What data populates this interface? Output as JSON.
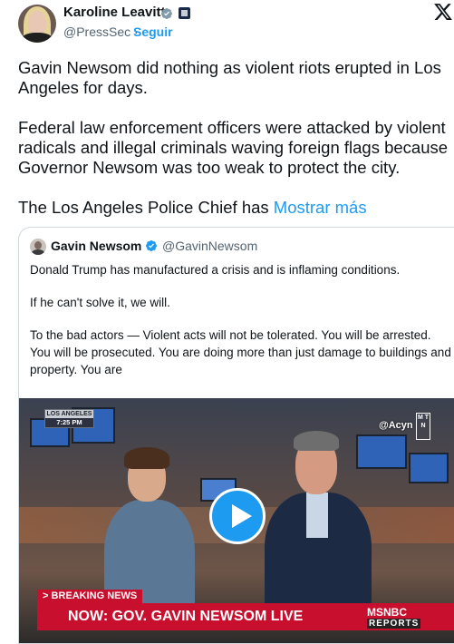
{
  "tweet": {
    "author_name": "Karoline Leavitt",
    "handle": "@PressSec",
    "separator": "·",
    "follow_label": "Seguir",
    "paragraphs": [
      "Gavin Newsom did nothing as violent riots erupted in Los Angeles for days.",
      "Federal law enforcement officers were attacked by violent radicals and illegal criminals waving foreign flags because Governor Newsom was too weak to protect the city."
    ],
    "truncated_text": "The Los Angeles Police Chief has",
    "show_more_label": "Mostrar más"
  },
  "quote": {
    "author_name": "Gavin Newsom",
    "handle": "@GavinNewsom",
    "paragraphs": [
      "Donald Trump has manufactured a crisis and is inflaming conditions.",
      "If he can't solve it, we will.",
      "To the bad actors — Violent acts will not be tolerated. You will be arrested. You will be prosecuted. You are doing more than just damage to buildings and property. You are"
    ]
  },
  "video": {
    "location": "LOS ANGELES",
    "time": "7:25 PM",
    "watermark": "@Acyn",
    "watermark_box": "M T N",
    "breaking_label": "> BREAKING NEWS",
    "headline": "NOW: GOV. GAVIN NEWSOM LIVE",
    "network_top": "MSNBC",
    "network_bottom": "REPORTS"
  },
  "colors": {
    "link": "#1d9bf0",
    "text": "#0f1419",
    "muted": "#536471",
    "border": "#cfd9de",
    "breaking_red": "#c8102e"
  },
  "icons": [
    "verified-badge-icon",
    "organization-badge-icon",
    "x-logo-icon",
    "play-icon"
  ]
}
